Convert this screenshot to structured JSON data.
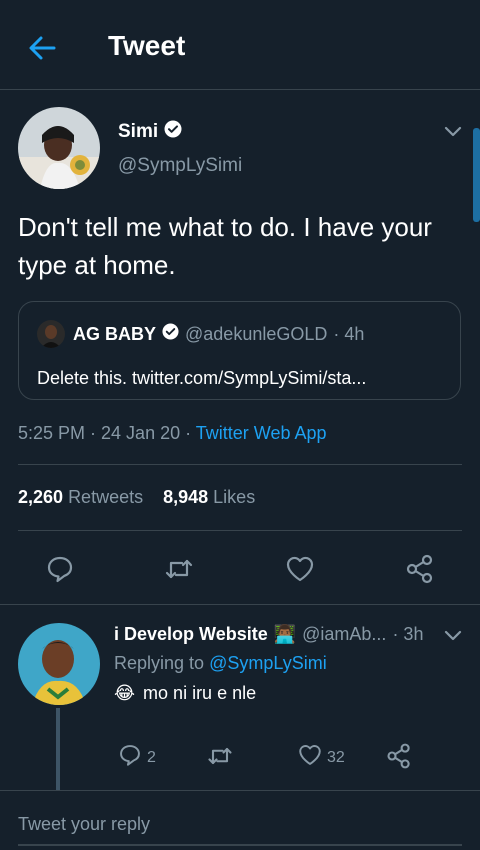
{
  "header": {
    "title": "Tweet"
  },
  "tweet": {
    "author_name": "Simi",
    "author_handle": "@SympLySimi",
    "text": "Don't tell me what to do. I have your type at home.",
    "quoted": {
      "author_name": "AG BABY",
      "author_handle": "@adekunleGOLD",
      "time": "· 4h",
      "text": "Delete this. twitter.com/SympLySimi/sta..."
    },
    "time": "5:25 PM · 24 Jan 20 ·",
    "source": "Twitter Web App",
    "retweets_count": "2,260",
    "retweets_label": "Retweets",
    "likes_count": "8,948",
    "likes_label": "Likes"
  },
  "reply": {
    "author_name": "i Develop Website",
    "author_emoji": "👨🏾‍💻",
    "author_handle": "@iamAb...",
    "time": "· 3h",
    "replying_prefix": "Replying to",
    "replying_handle": "@SympLySimi",
    "emoji": "😂",
    "text": "mo ni iru e nle",
    "reply_count": "2",
    "like_count": "32"
  },
  "compose": {
    "placeholder": "Tweet your reply"
  },
  "colors": {
    "background": "#15202b",
    "accent": "#1da1f2",
    "muted": "#8899a6",
    "border": "#38444d"
  },
  "icons": [
    "back-arrow-icon",
    "verified-badge-icon",
    "chevron-down-icon",
    "reply-icon",
    "retweet-icon",
    "like-icon",
    "share-icon"
  ]
}
